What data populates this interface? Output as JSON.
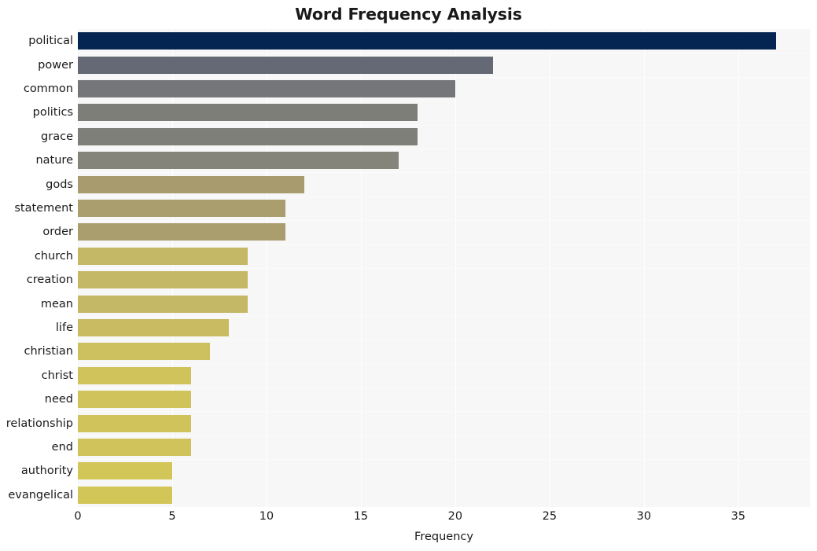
{
  "chart_data": {
    "type": "bar",
    "orientation": "horizontal",
    "title": "Word Frequency Analysis",
    "xlabel": "Frequency",
    "ylabel": "",
    "categories": [
      "political",
      "power",
      "common",
      "politics",
      "grace",
      "nature",
      "gods",
      "statement",
      "order",
      "church",
      "creation",
      "mean",
      "life",
      "christian",
      "christ",
      "need",
      "relationship",
      "end",
      "authority",
      "evangelical"
    ],
    "values": [
      37,
      22,
      20,
      18,
      18,
      17,
      12,
      11,
      11,
      9,
      9,
      9,
      8,
      7,
      6,
      6,
      6,
      6,
      5,
      5
    ],
    "bar_colors": [
      "#042551",
      "#656975",
      "#74767a",
      "#7e7e79",
      "#7f7f79",
      "#85847a",
      "#a89b6e",
      "#aa9d6e",
      "#aa9d6e",
      "#c4b765",
      "#c4b765",
      "#c4b765",
      "#c8bb62",
      "#cdc05f",
      "#d0c35c",
      "#d0c35c",
      "#d0c35c",
      "#d0c35c",
      "#d3c659",
      "#d3c659"
    ],
    "xlim": [
      0,
      38.8
    ],
    "xticks": [
      0,
      5,
      10,
      15,
      20,
      25,
      30,
      35
    ],
    "xtick_labels": [
      "0",
      "5",
      "10",
      "15",
      "20",
      "25",
      "30",
      "35"
    ],
    "grid": true,
    "grid_color": "#ffffff",
    "plot_background": "#f7f7f7",
    "figure_background": "#ffffff",
    "legend": null
  }
}
